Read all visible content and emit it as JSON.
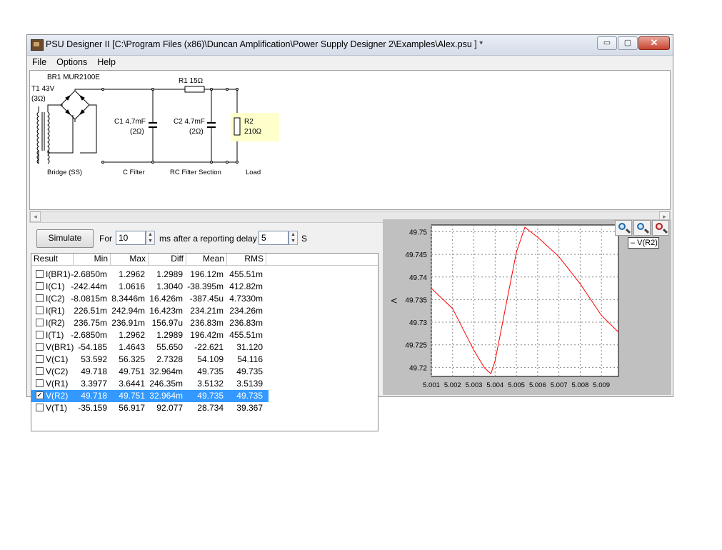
{
  "window": {
    "title": "PSU Designer II  [C:\\Program Files (x86)\\Duncan Amplification\\Power Supply Designer 2\\Examples\\Alex.psu ] *",
    "minimize": "▭",
    "maximize": "▢",
    "close": "✕"
  },
  "menu": [
    "File",
    "Options",
    "Help"
  ],
  "schematic": {
    "rectifier": "BR1 MUR2100E",
    "transformer": "T1 43V",
    "transformer_r": "(3Ω)",
    "r1": "R1 15Ω",
    "c1": "C1 4.7mF",
    "c1_r": "(2Ω)",
    "c2": "C2 4.7mF",
    "c2_r": "(2Ω)",
    "r2": "R2",
    "r2_val": "210Ω",
    "sec_bridge": "Bridge (SS)",
    "sec_cfilter": "C Filter",
    "sec_rc": "RC Filter Section",
    "sec_load": "Load"
  },
  "scroll": {
    "left": "◂",
    "right": "▸"
  },
  "sim": {
    "button": "Simulate",
    "for_label": "For",
    "for_value": "10",
    "ms_label": "ms",
    "delay_label": "after a reporting delay of",
    "delay_value": "5",
    "s_label": "S",
    "spin_up": "▲",
    "spin_down": "▼"
  },
  "results": {
    "headers": [
      "Result",
      "Min",
      "Max",
      "Diff",
      "Mean",
      "RMS"
    ],
    "rows": [
      {
        "name": "I(BR1)",
        "min": "-2.6850m",
        "max": "1.2962",
        "diff": "1.2989",
        "mean": "196.12m",
        "rms": "455.51m",
        "checked": false
      },
      {
        "name": "I(C1)",
        "min": "-242.44m",
        "max": "1.0616",
        "diff": "1.3040",
        "mean": "-38.395m",
        "rms": "412.82m",
        "checked": false
      },
      {
        "name": "I(C2)",
        "min": "-8.0815m",
        "max": "8.3446m",
        "diff": "16.426m",
        "mean": "-387.45u",
        "rms": "4.7330m",
        "checked": false
      },
      {
        "name": "I(R1)",
        "min": "226.51m",
        "max": "242.94m",
        "diff": "16.423m",
        "mean": "234.21m",
        "rms": "234.26m",
        "checked": false
      },
      {
        "name": "I(R2)",
        "min": "236.75m",
        "max": "236.91m",
        "diff": "156.97u",
        "mean": "236.83m",
        "rms": "236.83m",
        "checked": false
      },
      {
        "name": "I(T1)",
        "min": "-2.6850m",
        "max": "1.2962",
        "diff": "1.2989",
        "mean": "196.42m",
        "rms": "455.51m",
        "checked": false
      },
      {
        "name": "V(BR1)",
        "min": "-54.185",
        "max": "1.4643",
        "diff": "55.650",
        "mean": "-22.621",
        "rms": "31.120",
        "checked": false
      },
      {
        "name": "V(C1)",
        "min": "53.592",
        "max": "56.325",
        "diff": "2.7328",
        "mean": "54.109",
        "rms": "54.116",
        "checked": false
      },
      {
        "name": "V(C2)",
        "min": "49.718",
        "max": "49.751",
        "diff": "32.964m",
        "mean": "49.735",
        "rms": "49.735",
        "checked": false
      },
      {
        "name": "V(R1)",
        "min": "3.3977",
        "max": "3.6441",
        "diff": "246.35m",
        "mean": "3.5132",
        "rms": "3.5139",
        "checked": false
      },
      {
        "name": "V(R2)",
        "min": "49.718",
        "max": "49.751",
        "diff": "32.964m",
        "mean": "49.735",
        "rms": "49.735",
        "checked": true
      },
      {
        "name": "V(T1)",
        "min": "-35.159",
        "max": "56.917",
        "diff": "92.077",
        "mean": "28.734",
        "rms": "39.367",
        "checked": false
      }
    ]
  },
  "plot": {
    "legend": "– V(R2)",
    "colors": {
      "trace": "#ff0000",
      "grid": "#888888"
    },
    "zoom_icons": [
      "zoom-in-icon",
      "zoom-out-icon",
      "zoom-reset-icon"
    ]
  },
  "chart_data": {
    "type": "line",
    "title": "",
    "xlabel": "",
    "ylabel": "V",
    "xlim": [
      5.001,
      5.0098
    ],
    "ylim": [
      49.718,
      49.7515
    ],
    "grid": true,
    "x_ticks": [
      "5.001",
      "5.002",
      "5.003",
      "5.004",
      "5.005",
      "5.006",
      "5.007",
      "5.008",
      "5.009"
    ],
    "y_ticks": [
      "49.75",
      "49.745",
      "49.74",
      "49.735",
      "49.73",
      "49.725",
      "49.72"
    ],
    "series": [
      {
        "name": "V(R2)",
        "x": [
          5.001,
          5.002,
          5.003,
          5.0035,
          5.0038,
          5.004,
          5.005,
          5.0054,
          5.006,
          5.007,
          5.008,
          5.009,
          5.0098
        ],
        "y": [
          49.7375,
          49.733,
          49.7238,
          49.7199,
          49.7186,
          49.7215,
          49.7455,
          49.751,
          49.7488,
          49.7445,
          49.7385,
          49.7315,
          49.7278
        ]
      }
    ],
    "legend": "top-right"
  }
}
